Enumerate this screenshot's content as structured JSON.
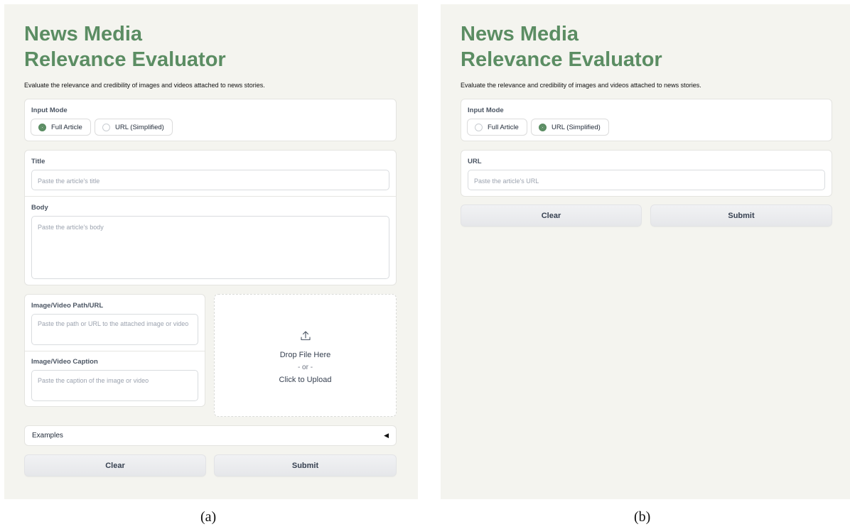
{
  "panel_a": {
    "title_line1": "News Media",
    "title_line2": "Relevance Evaluator",
    "description": "Evaluate the relevance and credibility of images and videos attached to news stories.",
    "input_mode": {
      "label": "Input Mode",
      "options": [
        "Full Article",
        "URL (Simplified)"
      ],
      "selected": "Full Article"
    },
    "title_field": {
      "label": "Title",
      "placeholder": "Paste the article's title"
    },
    "body_field": {
      "label": "Body",
      "placeholder": "Paste the article's body"
    },
    "media_path": {
      "label": "Image/Video Path/URL",
      "placeholder": "Paste the path or URL to the attached image or video"
    },
    "media_caption": {
      "label": "Image/Video Caption",
      "placeholder": "Paste the caption of the image or video"
    },
    "upload": {
      "icon": "upload-icon",
      "line1": "Drop File Here",
      "line2": "- or -",
      "line3": "Click to Upload"
    },
    "examples": {
      "label": "Examples",
      "icon": "triangle-left-icon"
    },
    "clear_label": "Clear",
    "submit_label": "Submit",
    "caption": "(a)"
  },
  "panel_b": {
    "title_line1": "News Media",
    "title_line2": "Relevance Evaluator",
    "description": "Evaluate the relevance and credibility of images and videos attached to news stories.",
    "input_mode": {
      "label": "Input Mode",
      "options": [
        "Full Article",
        "URL (Simplified)"
      ],
      "selected": "URL (Simplified)"
    },
    "url_field": {
      "label": "URL",
      "placeholder": "Paste the article's URL"
    },
    "clear_label": "Clear",
    "submit_label": "Submit",
    "caption": "(b)"
  },
  "colors": {
    "accent": "#5b8d63",
    "panel_bg": "#f4f4ef",
    "button_bg": "#e9eaec"
  }
}
